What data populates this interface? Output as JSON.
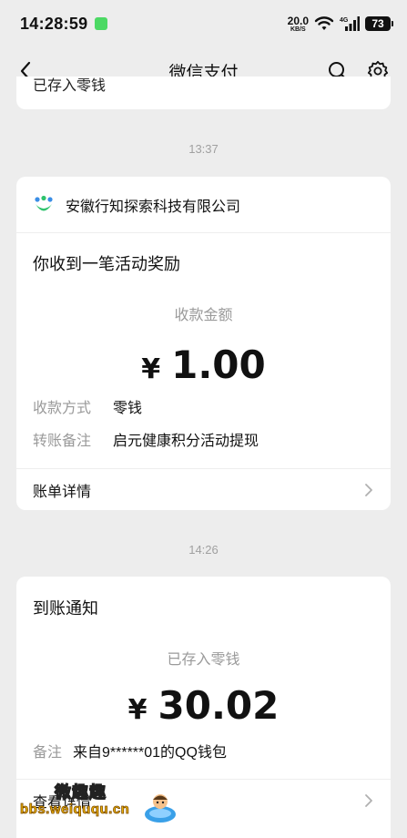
{
  "status_bar": {
    "time": "14:28:59",
    "net_speed_value": "20.0",
    "net_speed_unit": "KB/S",
    "network": "4G",
    "battery": "73"
  },
  "nav": {
    "title": "微信支付"
  },
  "prev_card": {
    "partial_text": "已存入零钱"
  },
  "messages": [
    {
      "time": "13:37",
      "merchant": "安徽行知探索科技有限公司",
      "heading": "你收到一笔活动奖励",
      "amount_label": "收款金额",
      "currency": "¥",
      "amount": "1.00",
      "details": [
        {
          "label": "收款方式",
          "value": "零钱"
        },
        {
          "label": "转账备注",
          "value": "启元健康积分活动提现"
        }
      ],
      "link": "账单详情"
    },
    {
      "time": "14:26",
      "heading": "到账通知",
      "amount_label": "已存入零钱",
      "currency": "¥",
      "amount": "30.02",
      "details": [
        {
          "label": "备注",
          "value": "来自9******01的QQ钱包"
        }
      ],
      "link": "查看详情"
    }
  ],
  "watermark": {
    "line1": "微趣趣",
    "line2": "bbs.weiququ.cn"
  },
  "colors": {
    "background": "#ededed",
    "card": "#ffffff",
    "muted_text": "#9a9a9a",
    "logo_green": "#2fc36d",
    "logo_blue": "#3a8ee6"
  }
}
